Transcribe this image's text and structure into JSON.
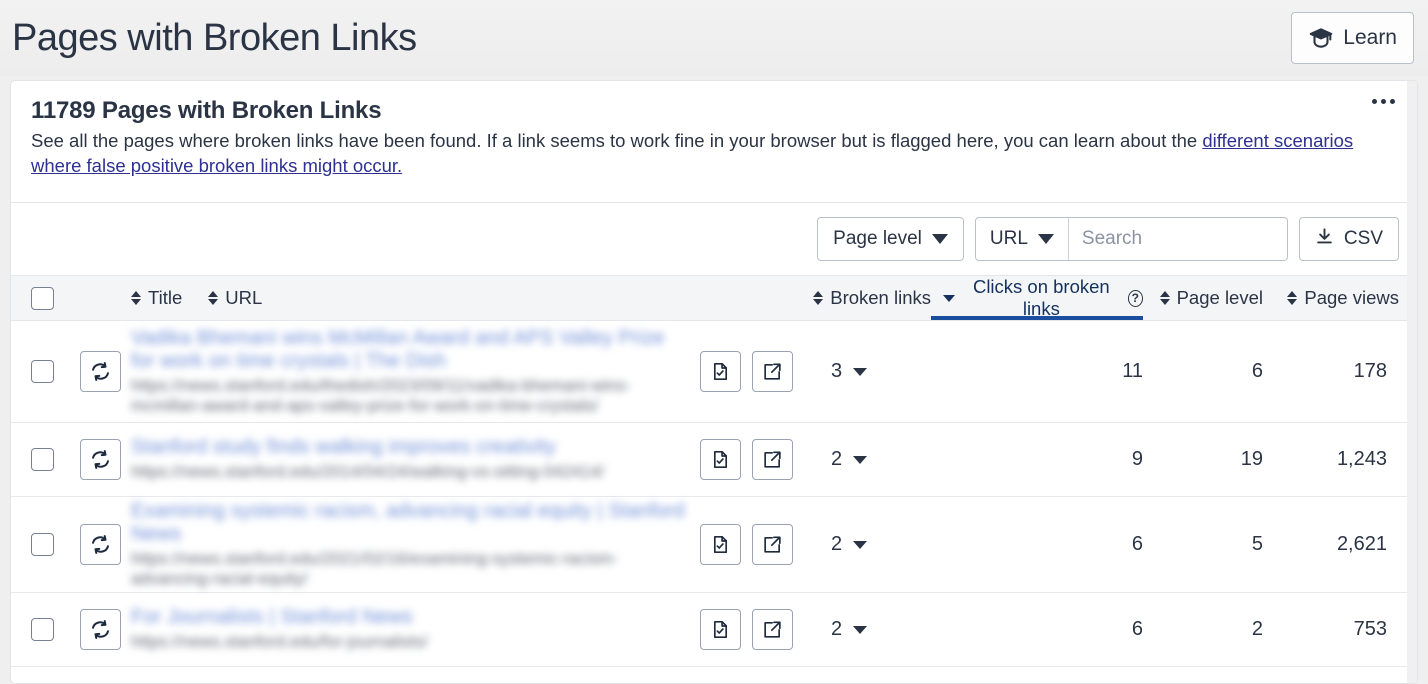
{
  "page": {
    "title": "Pages with Broken Links",
    "learn_button": "Learn",
    "learn_icon": "graduation-cap-icon"
  },
  "card": {
    "title": "11789 Pages with Broken Links",
    "description_part1": "See all the pages where broken links have been found. If a link seems to work fine in your browser but is flagged here, you can learn about the ",
    "description_link": "different scenarios where false positive broken links might occur.",
    "kebab_icon": "more-options-icon"
  },
  "toolbar": {
    "page_level_filter": "Page level",
    "url_filter": "URL",
    "search_placeholder": "Search",
    "search_value": "",
    "csv_button": "CSV",
    "csv_icon": "download-icon"
  },
  "table": {
    "columns": {
      "select_all": "",
      "title": "Title",
      "url": "URL",
      "broken_links": "Broken links",
      "clicks_on_broken_links": "Clicks on broken links",
      "page_level": "Page level",
      "page_views": "Page views"
    },
    "sorted_column": "Clicks on broken links",
    "sort_direction": "descending",
    "help_icon": "help-circle-icon",
    "loading_icon": "spinner-icon",
    "rows": [
      {
        "refresh_icon": "refresh-icon",
        "title": "Vadika Bhemani wins McMillan Award and APS Valley Prize for work on time crystals | The Dish",
        "url": "https://news.stanford.edu/thedish/2023/09/11/vadika-bhemani-wins-mcmillan-award-and-aps-valley-prize-for-work-on-time-crystals/",
        "check_icon": "document-check-icon",
        "open_icon": "external-link-icon",
        "broken_links": "3",
        "clicks_on_broken_links": "11",
        "page_level": "6",
        "page_views": "178"
      },
      {
        "refresh_icon": "refresh-icon",
        "title": "Stanford study finds walking improves creativity",
        "url": "https://news.stanford.edu/2014/04/24/walking-vs-sitting-042414/",
        "check_icon": "document-check-icon",
        "open_icon": "external-link-icon",
        "broken_links": "2",
        "clicks_on_broken_links": "9",
        "page_level": "19",
        "page_views": "1,243"
      },
      {
        "refresh_icon": "refresh-icon",
        "title": "Examining systemic racism, advancing racial equity | Stanford News",
        "url": "https://news.stanford.edu/2021/02/16/examining-systemic-racism-advancing-racial-equity/",
        "check_icon": "document-check-icon",
        "open_icon": "external-link-icon",
        "broken_links": "2",
        "clicks_on_broken_links": "6",
        "page_level": "5",
        "page_views": "2,621"
      },
      {
        "refresh_icon": "refresh-icon",
        "title": "For Journalists | Stanford News",
        "url": "https://news.stanford.edu/for-journalists/",
        "check_icon": "document-check-icon",
        "open_icon": "external-link-icon",
        "broken_links": "2",
        "clicks_on_broken_links": "6",
        "page_level": "2",
        "page_views": "753"
      }
    ]
  },
  "colors": {
    "text": "#2b3445",
    "link": "#2e3192",
    "accent": "#1b4d9e",
    "page_bg": "#efefef",
    "header_row_bg": "#f4f5f7"
  }
}
